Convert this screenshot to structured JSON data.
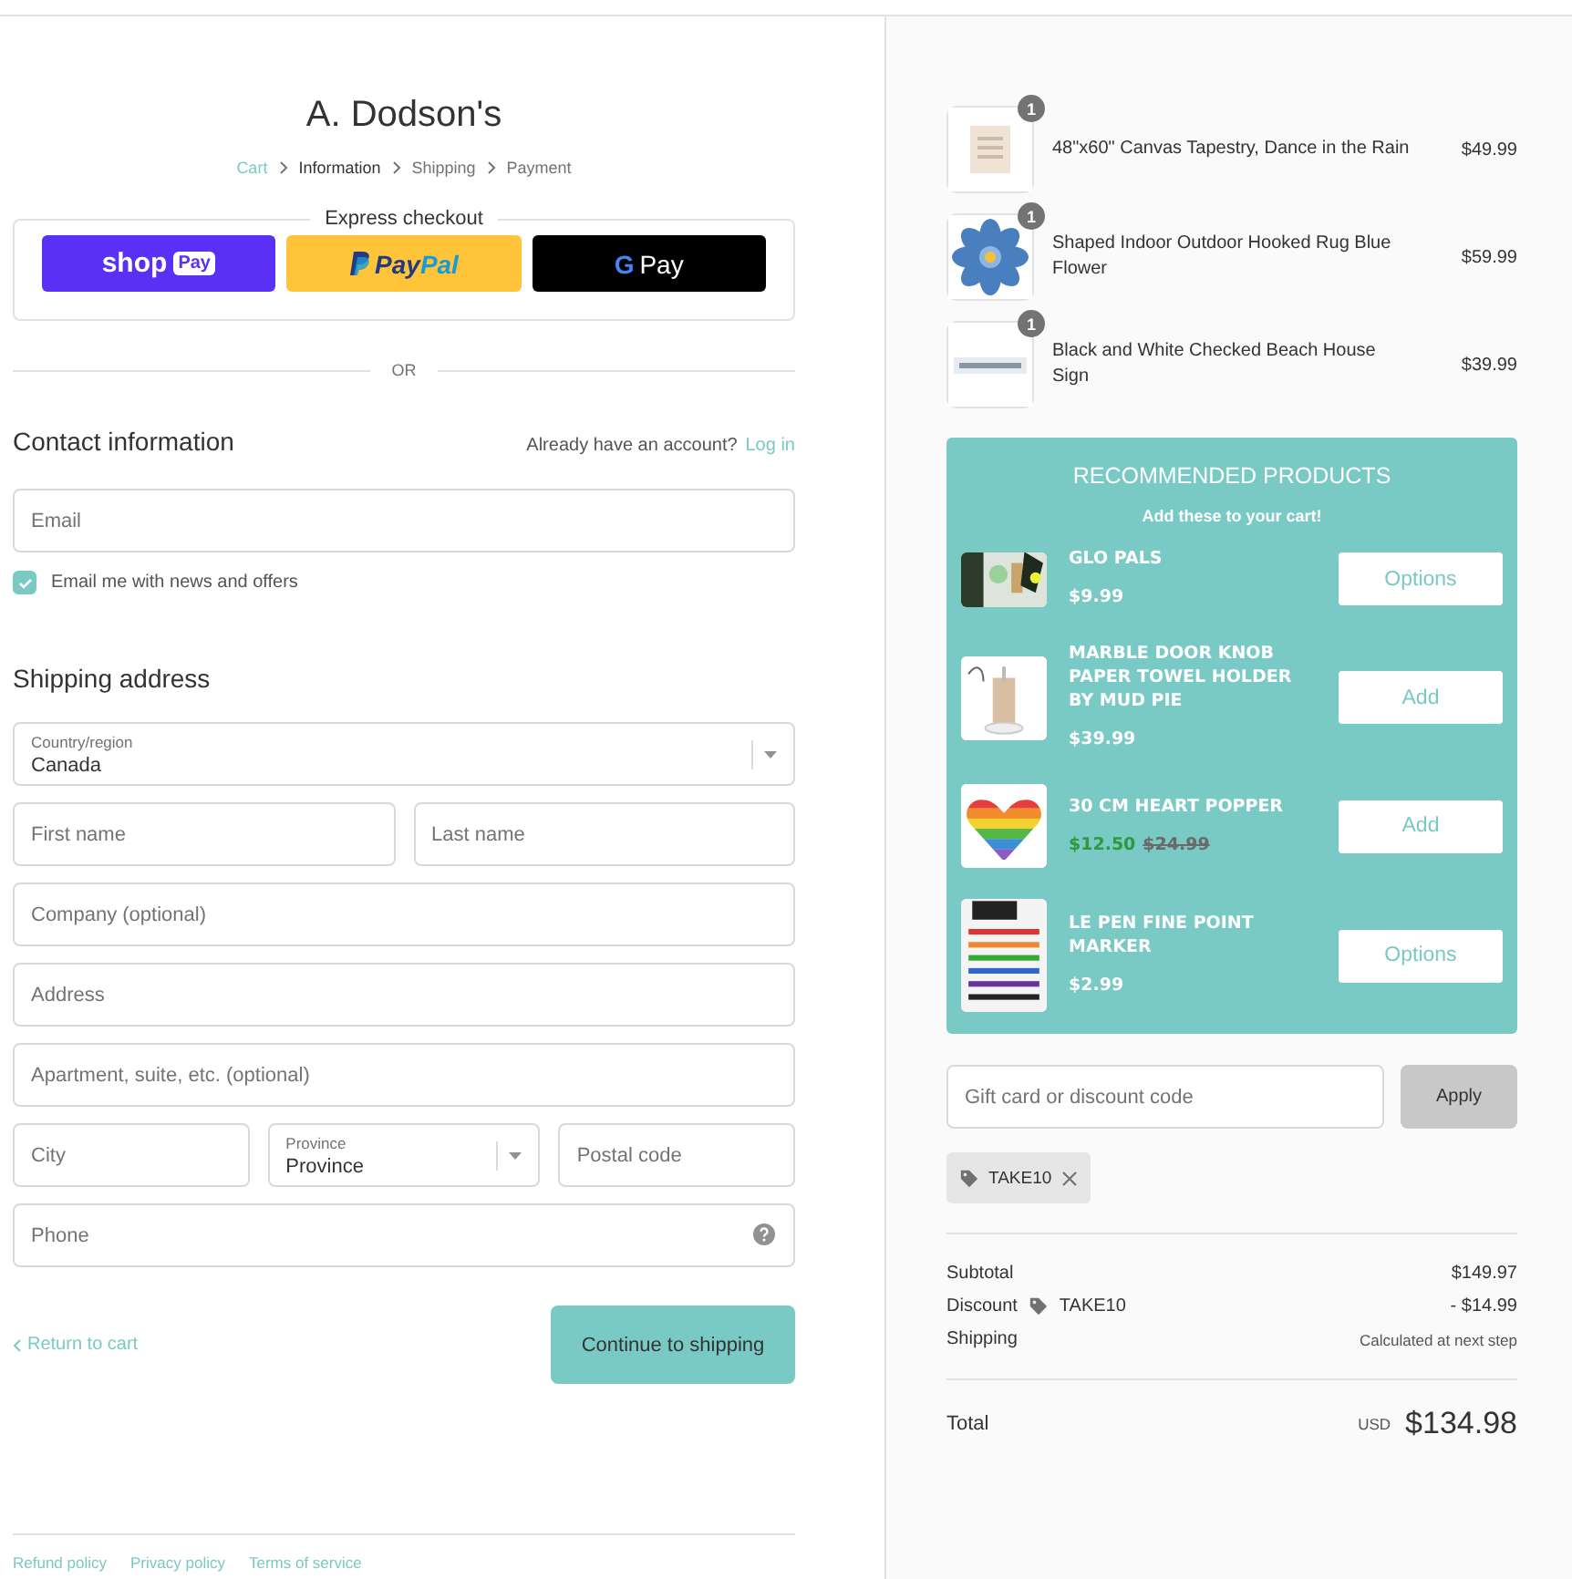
{
  "store": {
    "title": "A. Dodson's"
  },
  "breadcrumbs": [
    {
      "label": "Cart",
      "kind": "link"
    },
    {
      "label": "Information",
      "kind": "current"
    },
    {
      "label": "Shipping",
      "kind": "pending"
    },
    {
      "label": "Payment",
      "kind": "pending"
    }
  ],
  "express_checkout": {
    "title": "Express checkout",
    "buttons": [
      {
        "kind": "shop",
        "parts": [
          "shop",
          "Pay"
        ]
      },
      {
        "kind": "paypal",
        "parts": [
          "Pay",
          "Pal"
        ]
      },
      {
        "kind": "gpay",
        "parts": [
          "G",
          "Pay"
        ]
      }
    ]
  },
  "divider_label": "OR",
  "contact": {
    "title": "Contact information",
    "account_prompt": "Already have an account?",
    "login_link": "Log in",
    "email": {
      "placeholder": "Email"
    },
    "newsletter": {
      "label": "Email me with news and offers",
      "checked": true
    }
  },
  "shipping": {
    "title": "Shipping address",
    "rows": [
      [
        {
          "kind": "select",
          "label": "Country/region",
          "value": "Canada"
        }
      ],
      [
        {
          "kind": "text",
          "placeholder": "First name"
        },
        {
          "kind": "text",
          "placeholder": "Last name"
        }
      ],
      [
        {
          "kind": "text",
          "placeholder": "Company (optional)"
        }
      ],
      [
        {
          "kind": "text",
          "placeholder": "Address"
        }
      ],
      [
        {
          "kind": "text",
          "placeholder": "Apartment, suite, etc. (optional)"
        }
      ],
      [
        {
          "kind": "text",
          "placeholder": "City"
        },
        {
          "kind": "select",
          "label": "Province",
          "value": "Province"
        },
        {
          "kind": "text",
          "placeholder": "Postal code"
        }
      ],
      [
        {
          "kind": "help",
          "placeholder": "Phone"
        }
      ]
    ]
  },
  "actions": {
    "back": "Return to cart",
    "continue": "Continue to shipping"
  },
  "footer_links": [
    "Refund policy",
    "Privacy policy",
    "Terms of service"
  ],
  "cart_items": [
    {
      "name": "48\"x60\" Canvas Tapestry, Dance in the Rain",
      "price": "$49.99",
      "quantity": "1"
    },
    {
      "name": "Shaped Indoor Outdoor Hooked Rug Blue Flower",
      "price": "$59.99",
      "quantity": "1"
    },
    {
      "name": "Black and White Checked Beach House Sign",
      "price": "$39.99",
      "quantity": "1"
    }
  ],
  "recommended": {
    "title": "RECOMMENDED PRODUCTS",
    "subtitle": "Add these to your cart!",
    "items": [
      {
        "name": "GLO PALS",
        "price": "$9.99",
        "action": "Options"
      },
      {
        "name": "MARBLE DOOR KNOB PAPER TOWEL HOLDER BY MUD PIE",
        "price": "$39.99",
        "action": "Add"
      },
      {
        "name": "30 CM HEART POPPER",
        "price": "$12.50",
        "compare_price": "$24.99",
        "action": "Add"
      },
      {
        "name": "LE PEN FINE POINT MARKER",
        "price": "$2.99",
        "action": "Options"
      }
    ]
  },
  "discount": {
    "placeholder": "Gift card or discount code",
    "apply": "Apply",
    "applied_code": "TAKE10"
  },
  "summary": {
    "rows": [
      {
        "label": "Subtotal",
        "value": "$149.97",
        "kind": "plain"
      },
      {
        "label": "Discount",
        "code": "TAKE10",
        "value": "- $14.99",
        "kind": "code"
      },
      {
        "label": "Shipping",
        "value": "Calculated at next step",
        "kind": "note"
      }
    ],
    "total": {
      "label": "Total",
      "currency": "USD",
      "value": "$134.98"
    }
  }
}
